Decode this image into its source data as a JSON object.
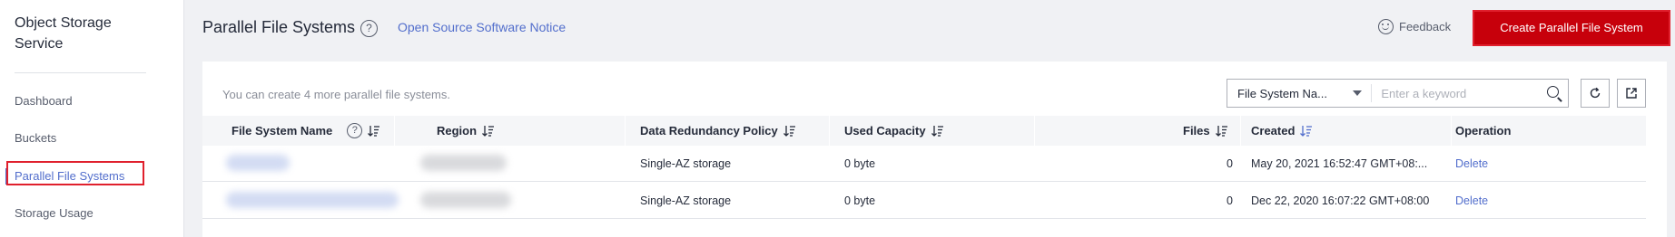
{
  "sidebar": {
    "title": "Object Storage Service",
    "items": [
      {
        "label": "Dashboard",
        "active": false
      },
      {
        "label": "Buckets",
        "active": false
      },
      {
        "label": "Parallel File Systems",
        "active": true
      },
      {
        "label": "Storage Usage",
        "active": false
      }
    ]
  },
  "header": {
    "title": "Parallel File Systems",
    "help_icon": "question-circle-icon",
    "notice_link": "Open Source Software Notice",
    "feedback_label": "Feedback",
    "feedback_icon": "smile-icon",
    "create_button": "Create Parallel File System"
  },
  "toolbar": {
    "quota_text": "You can create 4 more parallel file systems.",
    "search_filter": "File System Na...",
    "search_placeholder": "Enter a keyword",
    "refresh_icon": "refresh-icon",
    "export_icon": "export-icon"
  },
  "table": {
    "columns": [
      {
        "label": "File System Name",
        "help": true,
        "sort": true
      },
      {
        "label": "Region",
        "sort": true
      },
      {
        "label": "Data Redundancy Policy",
        "sort": true
      },
      {
        "label": "Used Capacity",
        "sort": true
      },
      {
        "label": "Files",
        "sort": true
      },
      {
        "label": "Created",
        "sort": true,
        "sort_active": true
      },
      {
        "label": "Operation"
      }
    ],
    "rows": [
      {
        "name": "",
        "region": "",
        "redundancy": "Single-AZ storage",
        "used_capacity": "0 byte",
        "files": "0",
        "created": "May 20, 2021 16:52:47 GMT+08:...",
        "operation": "Delete"
      },
      {
        "name": "",
        "region": "",
        "redundancy": "Single-AZ storage",
        "used_capacity": "0 byte",
        "files": "0",
        "created": "Dec 22, 2020 16:07:22 GMT+08:00",
        "operation": "Delete"
      }
    ]
  },
  "colors": {
    "accent": "#526ecc",
    "primary_button": "#c7000b",
    "highlight": "#e0202d"
  }
}
